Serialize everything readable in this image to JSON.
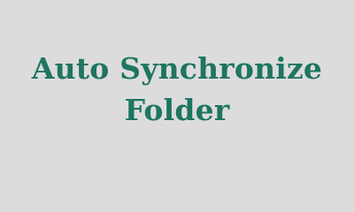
{
  "banner": {
    "title_lines": [
      "Auto Synchronize",
      "Folder"
    ],
    "background_color": "#dcdcdc",
    "text_color": "#1e7561"
  }
}
